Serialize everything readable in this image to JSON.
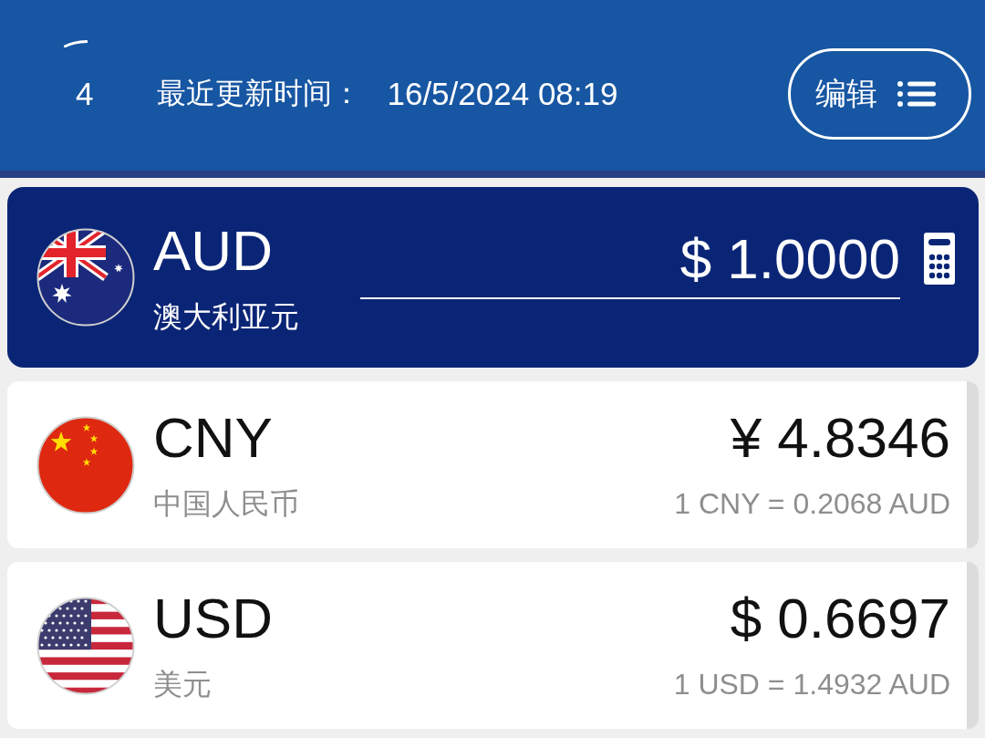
{
  "header": {
    "count": "4",
    "updated_label": "最近更新时间：",
    "updated_time": "16/5/2024 08:19",
    "edit_button": {
      "label": "编辑"
    }
  },
  "currencies": [
    {
      "kind": "australia",
      "code": "AUD",
      "name": "澳大利亚元",
      "amount": "$ 1.0000",
      "selected": true
    },
    {
      "kind": "china",
      "code": "CNY",
      "name": "中国人民币",
      "amount": "¥ 4.8346",
      "rate": "1 CNY = 0.2068 AUD",
      "selected": false
    },
    {
      "kind": "usa",
      "code": "USD",
      "name": "美元",
      "amount": "$ 0.6697",
      "rate": "1 USD = 1.4932 AUD",
      "selected": false
    }
  ]
}
